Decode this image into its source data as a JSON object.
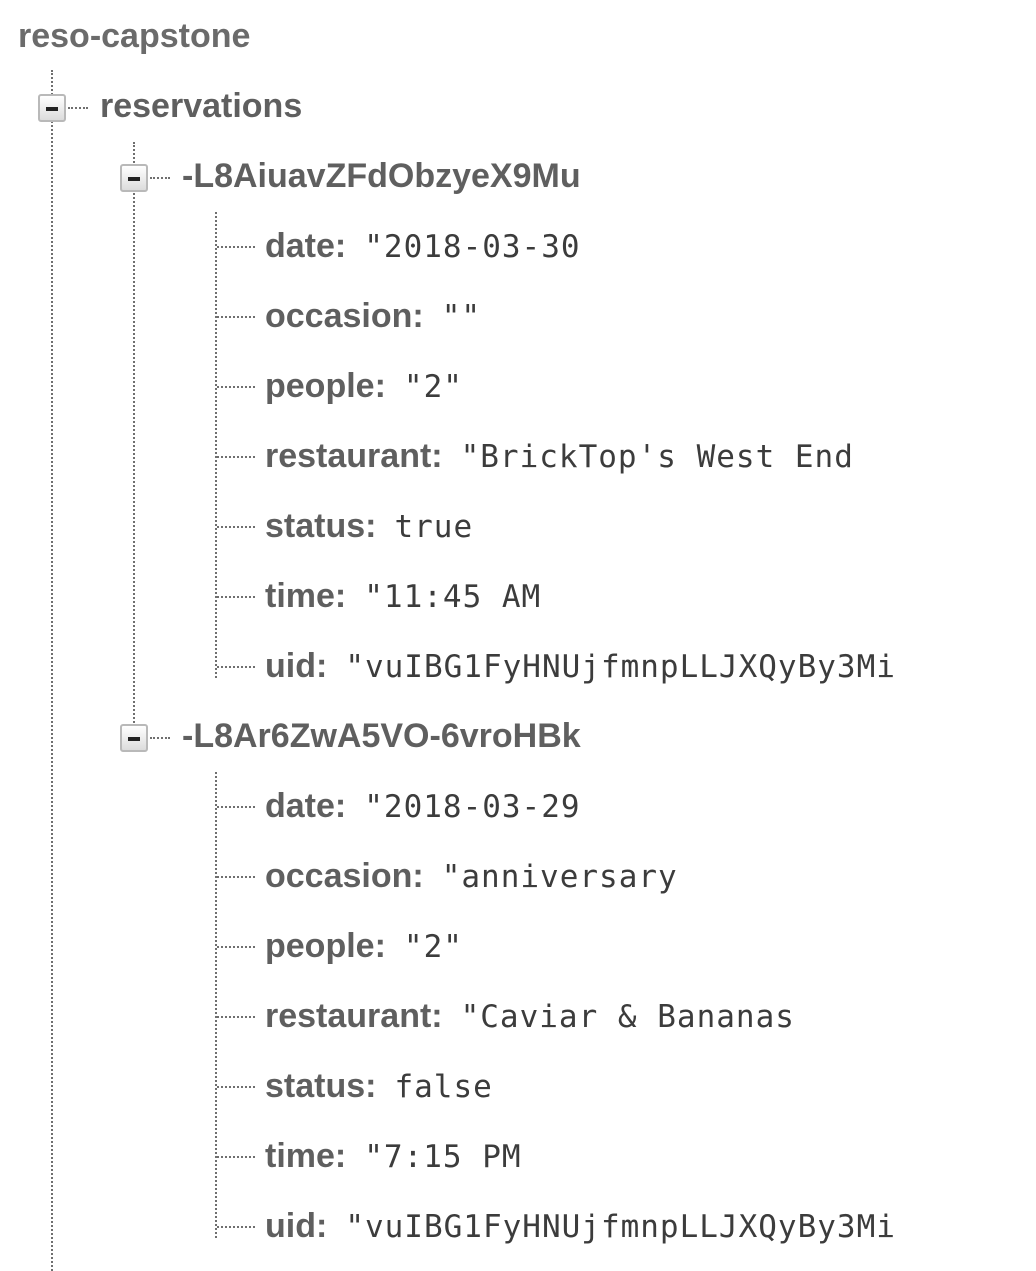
{
  "root": {
    "title": "reso-capstone"
  },
  "reservations": {
    "label": "reservations",
    "toggle_icon": "collapse-minus-icon",
    "records": [
      {
        "key": "-L8AiuavZFdObzyeX9Mu",
        "fields": [
          {
            "name": "date",
            "value": "\"2018-03-30"
          },
          {
            "name": "occasion",
            "value": "\"\""
          },
          {
            "name": "people",
            "value": "\"2\""
          },
          {
            "name": "restaurant",
            "value": "\"BrickTop's West End"
          },
          {
            "name": "status",
            "value": "true"
          },
          {
            "name": "time",
            "value": "\"11:45 AM"
          },
          {
            "name": "uid",
            "value": "\"vuIBG1FyHNUjfmnpLLJXQyBy3Mi"
          }
        ]
      },
      {
        "key": "-L8Ar6ZwA5VO-6vroHBk",
        "fields": [
          {
            "name": "date",
            "value": "\"2018-03-29"
          },
          {
            "name": "occasion",
            "value": "\"anniversary"
          },
          {
            "name": "people",
            "value": "\"2\""
          },
          {
            "name": "restaurant",
            "value": "\"Caviar & Bananas"
          },
          {
            "name": "status",
            "value": "false"
          },
          {
            "name": "time",
            "value": "\"7:15 PM"
          },
          {
            "name": "uid",
            "value": "\"vuIBG1FyHNUjfmnpLLJXQyBy3Mi"
          }
        ]
      }
    ]
  }
}
